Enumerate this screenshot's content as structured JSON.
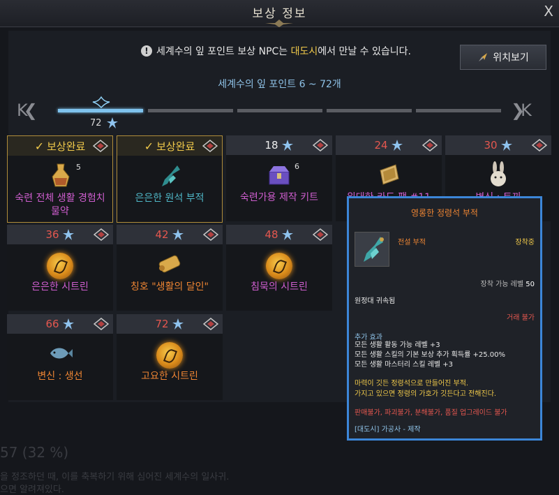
{
  "window": {
    "title": "보상 정보",
    "close_label": "X"
  },
  "notice": {
    "prefix": "세계수의 잎 포인트 보상 NPC는 ",
    "highlight": "대도시",
    "suffix": "에서 만날 수 있습니다."
  },
  "locate_button": "위치보기",
  "range_text": "세계수의 잎 포인트 6 ~ 72개",
  "progress": {
    "current": "72",
    "segments": 5,
    "active_segments": 1
  },
  "colors": {
    "accent_gold": "#f0c94a",
    "accent_blue": "#3c86d8",
    "points_red": "#e4574f"
  },
  "cards": [
    {
      "header": "보상완료",
      "done": true,
      "name": "숙련 전체 생활 경험치 물약",
      "count": "5",
      "icon": "potion-icon"
    },
    {
      "header": "보상완료",
      "done": true,
      "name": "은은한 원석 부적",
      "count": "",
      "icon": "stone-charm-icon"
    },
    {
      "header": "18",
      "done": false,
      "name": "숙련가용 제작 키트",
      "count": "6",
      "icon": "chest-icon"
    },
    {
      "header": "24",
      "done": false,
      "name": "위대한 카드 팩 #11",
      "count": "",
      "icon": "card-pack-icon"
    },
    {
      "header": "30",
      "done": false,
      "name": "변신 : 토끼",
      "count": "",
      "icon": "rabbit-icon"
    },
    {
      "header": "36",
      "done": false,
      "name": "은은한 시트린",
      "count": "",
      "icon": "citrine-icon"
    },
    {
      "header": "42",
      "done": false,
      "name": "칭호 \"생활의 달인\"",
      "count": "",
      "icon": "scroll-icon"
    },
    {
      "header": "48",
      "done": false,
      "name": "침묵의 시트린",
      "count": "",
      "icon": "citrine-icon"
    },
    {
      "header": "66",
      "done": false,
      "name": "변신 : 생선",
      "count": "",
      "icon": "fish-icon"
    },
    {
      "header": "72",
      "done": false,
      "name": "고요한 시트린",
      "count": "",
      "icon": "citrine-icon"
    }
  ],
  "tooltip": {
    "title": "영롱한 정령석 부적",
    "grade": "전설 부적",
    "equipped": "장착중",
    "req_label": "장착 가능 레벨",
    "req_value": "50",
    "bound": "원정대 귀속됨",
    "trade": "거래 불가",
    "effects_title": "추가 효과",
    "effects": [
      "모든 생활 활동 가능 레벨 +3",
      "모든 생활 스킬의 기본 보상 추가 획득률 +25.00%",
      "모든 생활 마스터리 스킬 레벨 +3"
    ],
    "desc": [
      "마력이 깃든 정령석으로 만들어진 부적.",
      "가지고 있으면 정령의 가호가 깃든다고 전해진다."
    ],
    "restrict": "판매불가, 파괴불가, 분해불가, 품질 업그레이드 불가",
    "craft": "[대도시] 가공사 - 제작"
  },
  "background_text": {
    "pct": "57 (32 %)",
    "line1": "을 정조하던 때, 이를 축복하기 위해 심어진 세계수의 일사귀.",
    "line2": "으면 알려져있다."
  }
}
